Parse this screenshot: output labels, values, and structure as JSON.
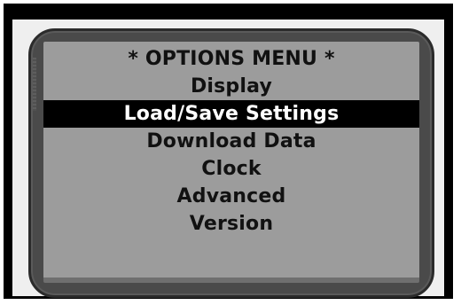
{
  "menu": {
    "title": "* OPTIONS MENU *",
    "items": [
      {
        "label": "Display",
        "selected": false
      },
      {
        "label": "Load/Save Settings",
        "selected": true
      },
      {
        "label": "Download Data",
        "selected": false
      },
      {
        "label": "Clock",
        "selected": false
      },
      {
        "label": "Advanced",
        "selected": false
      },
      {
        "label": "Version",
        "selected": false
      }
    ]
  },
  "colors": {
    "screen_background": "#9c9c9c",
    "selection_background": "#000000",
    "selection_text": "#ffffff",
    "text": "#111111",
    "bezel": "#4a4a4a"
  }
}
